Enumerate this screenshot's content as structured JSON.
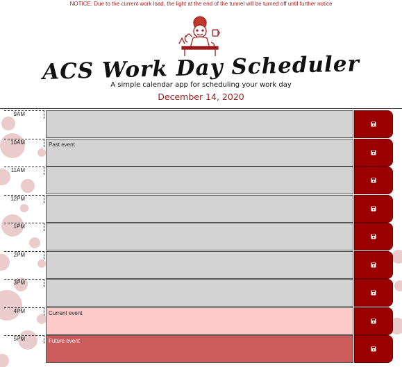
{
  "notice": "NOTICE: Due to the current work load, the light at the end of the tunnel will be turned off until further notice",
  "header": {
    "title": "ACS Work Day Scheduler",
    "subtitle": "A simple calendar app for scheduling your work day",
    "date": "December 14, 2020"
  },
  "save_icon": "floppy-disk-icon",
  "colors": {
    "accent": "#9b0000",
    "past": "#d3d3d3",
    "present": "#ffcaca",
    "future": "#cd5c5c"
  },
  "rows": [
    {
      "hour": "9AM",
      "text": "",
      "state": "past"
    },
    {
      "hour": "10AM",
      "text": "Past event",
      "state": "past"
    },
    {
      "hour": "11AM",
      "text": "",
      "state": "past"
    },
    {
      "hour": "12PM",
      "text": "",
      "state": "past"
    },
    {
      "hour": "1PM",
      "text": "",
      "state": "past"
    },
    {
      "hour": "2PM",
      "text": "",
      "state": "past"
    },
    {
      "hour": "3PM",
      "text": "",
      "state": "past"
    },
    {
      "hour": "4PM",
      "text": "Current event",
      "state": "present"
    },
    {
      "hour": "5PM",
      "text": "Future event",
      "state": "future"
    }
  ]
}
